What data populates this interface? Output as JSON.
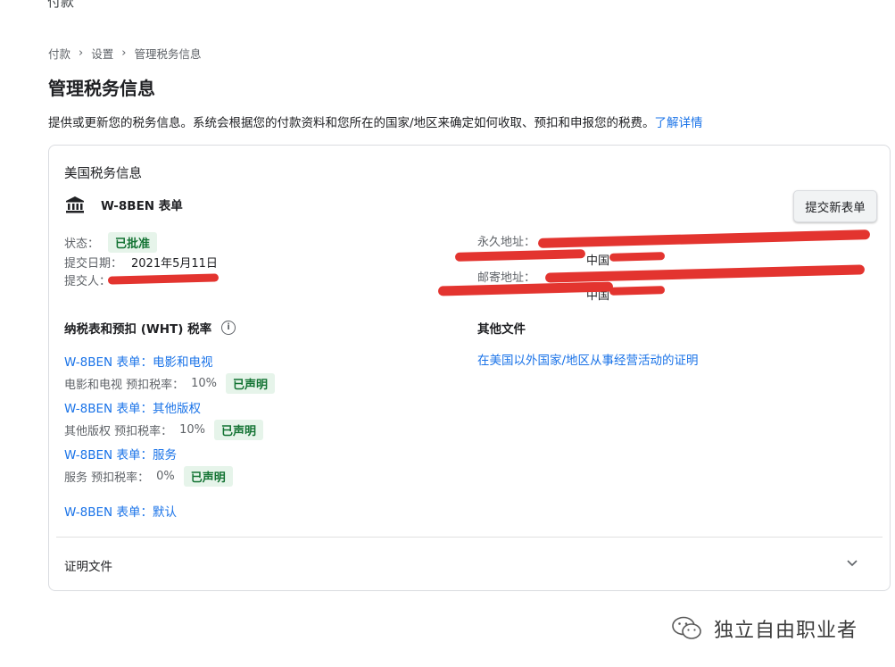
{
  "header_cut": "付款",
  "breadcrumb": [
    "付款",
    "设置",
    "管理税务信息"
  ],
  "page": {
    "title": "管理税务信息",
    "description": "提供或更新您的税务信息。系统会根据您的付款资料和您所在的国家/地区来确定如何收取、预扣和申报您的税费。",
    "learn_more": "了解详情"
  },
  "card": {
    "title": "美国税务信息",
    "form_icon": "bank-icon",
    "form_name": "W-8BEN 表单",
    "submit_button": "提交新表单",
    "status_label": "状态：",
    "status_value": "已批准",
    "submitted_date_label": "提交日期：",
    "submitted_date_value": "2021年5月11日",
    "submitter_label": "提交人：",
    "permanent_address_label": "永久地址：",
    "permanent_address_city": "中国",
    "mailing_address_label": "邮寄地址：",
    "mailing_address_city": "中国",
    "wht_title": "纳税表和预扣 (WHT) 税率",
    "wht_items": [
      {
        "link": "W-8BEN 表单：电影和电视",
        "rate_label": "电影和电视 预扣税率：",
        "rate": "10%",
        "badge": "已声明"
      },
      {
        "link": "W-8BEN 表单：其他版权",
        "rate_label": "其他版权 预扣税率：",
        "rate": "10%",
        "badge": "已声明"
      },
      {
        "link": "W-8BEN 表单：服务",
        "rate_label": "服务 预扣税率：",
        "rate": "0%",
        "badge": "已声明"
      }
    ],
    "default_link": "W-8BEN 表单：默认",
    "other_docs_title": "其他文件",
    "other_docs_link": "在美国以外国家/地区从事经营活动的证明",
    "proof_docs_title": "证明文件",
    "colors": {
      "link": "#1a73e8",
      "badge_bg": "#e6f4ea",
      "badge_text": "#137333",
      "redaction": "#e3342f"
    }
  },
  "watermark": {
    "text": "独立自由职业者"
  }
}
